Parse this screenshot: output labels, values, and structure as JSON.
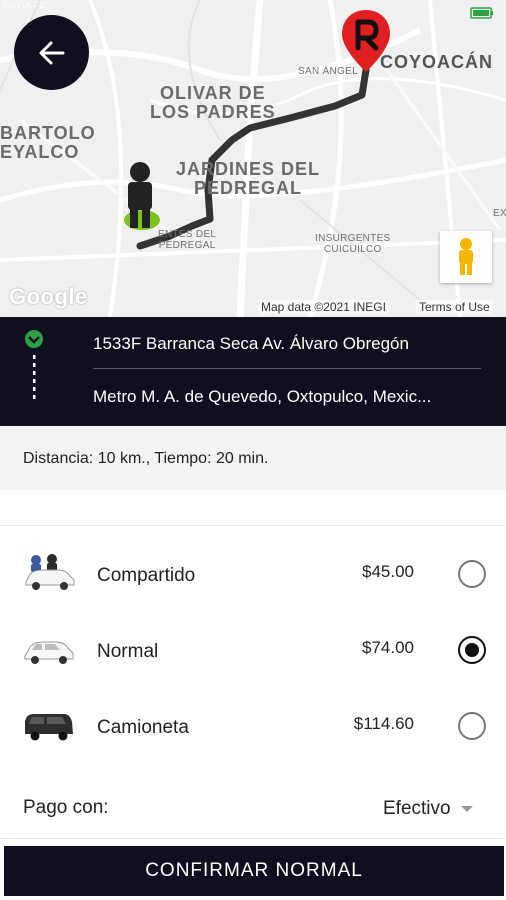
{
  "map": {
    "labels": {
      "santa_fe": "SANTA FE",
      "olivar": "OLIVAR DE\nLOS PADRES",
      "bartolo": "BARTOLO\nEYALCO",
      "jardines": "JARDINES DEL\nPEDREGAL",
      "san_angel": "SAN ÁNGEL",
      "coyoacan": "COYOACÁN",
      "insurgentes": "INSURGENTES\nCUICUILCO",
      "fuentes": "ENTES DEL\nPEDREGAL",
      "ex": "EX"
    },
    "google_logo": "Google",
    "map_data": "Map data ©2021 INEGI",
    "terms": "Terms of Use",
    "route_color": "#333333",
    "origin_color": "#7dc21e",
    "dest_color": "#e02020"
  },
  "route": {
    "origin": "1533F Barranca Seca Av. Álvaro Obregón",
    "destination": "Metro M. A. de Quevedo, Oxtopulco, Mexic..."
  },
  "trip": {
    "summary": "Distancia: 10 km., Tiempo: 20 min."
  },
  "options": [
    {
      "name": "Compartido",
      "price": "$45.00",
      "icon": "shared-car-icon",
      "selected": false
    },
    {
      "name": "Normal",
      "price": "$74.00",
      "icon": "sedan-icon",
      "selected": true
    },
    {
      "name": "Camioneta",
      "price": "$114.60",
      "icon": "van-icon",
      "selected": false
    }
  ],
  "payment": {
    "label": "Pago con:",
    "value": "Efectivo"
  },
  "confirm_label": "CONFIRMAR NORMAL",
  "colors": {
    "primary_dark": "#0f0f1e",
    "accent_green": "#2ea043"
  }
}
